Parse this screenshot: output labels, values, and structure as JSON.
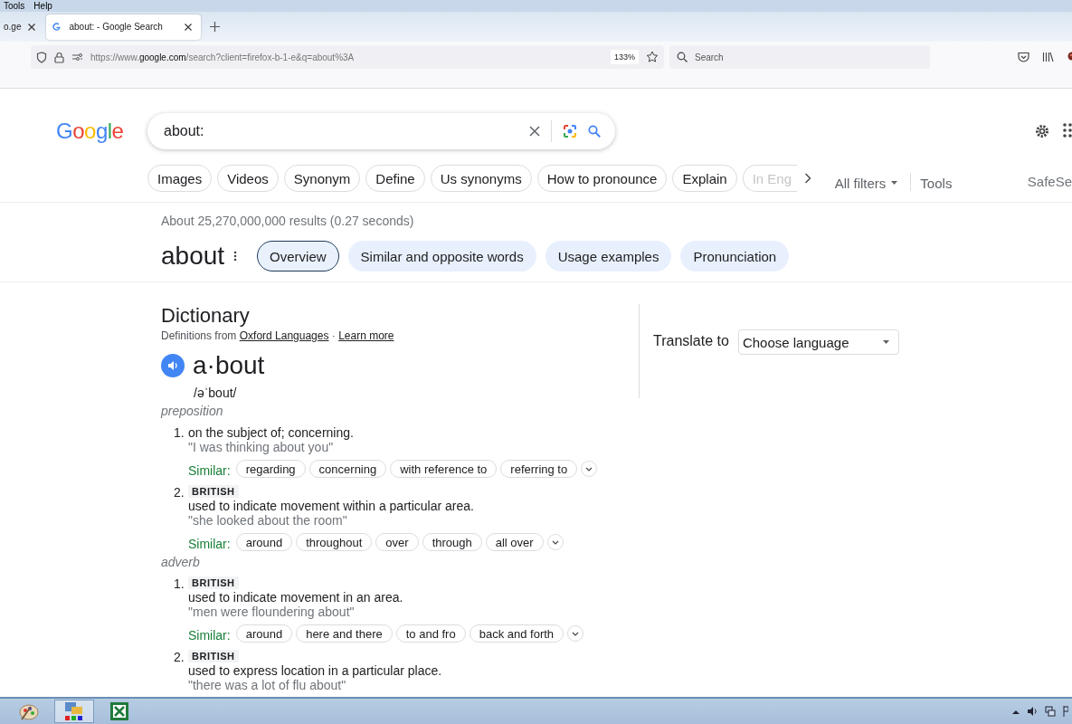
{
  "menu_bar": [
    "Tools",
    "Help"
  ],
  "browser_tabs": [
    {
      "title": "o.ge",
      "selected": false
    },
    {
      "title": "about: - Google Search",
      "selected": true
    }
  ],
  "address_bar": {
    "url": "https://www.**google.com**/search?client=firefox-b-1-e&q=about%3A",
    "zoom": "133%"
  },
  "search_field": {
    "placeholder": "Search"
  },
  "google": {
    "logo": "Google",
    "query": "about:",
    "chips": [
      {
        "label": "Images",
        "faded": false
      },
      {
        "label": "Videos",
        "faded": false
      },
      {
        "label": "Synonym",
        "faded": false
      },
      {
        "label": "Define",
        "faded": false
      },
      {
        "label": "Us synonyms",
        "faded": false
      },
      {
        "label": "How to pronounce",
        "faded": false
      },
      {
        "label": "Explain",
        "faded": false
      },
      {
        "label": "In Eng",
        "faded": true
      }
    ],
    "all_filters": "All filters",
    "tools": "Tools",
    "safesearch": "SafeSe",
    "stats": "About 25,270,000,000 results (0.27 seconds)"
  },
  "word": {
    "title": "about",
    "tabs": [
      {
        "label": "Overview",
        "selected": true
      },
      {
        "label": "Similar and opposite words",
        "selected": false
      },
      {
        "label": "Usage examples",
        "selected": false
      },
      {
        "label": "Pronunciation",
        "selected": false
      }
    ]
  },
  "dictionary": {
    "title": "Dictionary",
    "source_prefix": "Definitions from",
    "source_link": "Oxford Languages",
    "separator": "·",
    "learn_more": "Learn more",
    "headword": "a·bout",
    "pronunciation": "/əˈbout/",
    "parts": [
      {
        "pos": "preposition",
        "senses": [
          {
            "number": "1.",
            "definition": "on the subject of; concerning.",
            "example": "\"I was thinking about you\"",
            "similar_label": "Similar:",
            "similar": [
              "regarding",
              "concerning",
              "with reference to",
              "referring to"
            ]
          },
          {
            "number": "2.",
            "label": "BRITISH",
            "definition": "used to indicate movement within a particular area.",
            "example": "\"she looked about the room\"",
            "similar_label": "Similar:",
            "similar": [
              "around",
              "throughout",
              "over",
              "through",
              "all over"
            ]
          }
        ]
      },
      {
        "pos": "adverb",
        "senses": [
          {
            "number": "1.",
            "label": "BRITISH",
            "definition": "used to indicate movement in an area.",
            "example": "\"men were floundering about\"",
            "similar_label": "Similar:",
            "similar": [
              "around",
              "here and there",
              "to and fro",
              "back and forth"
            ]
          },
          {
            "number": "2.",
            "label": "BRITISH",
            "definition": "used to express location in a particular place.",
            "example": "\"there was a lot of flu about\""
          }
        ]
      }
    ]
  },
  "translate": {
    "label": "Translate to",
    "dropdown": "Choose language"
  }
}
